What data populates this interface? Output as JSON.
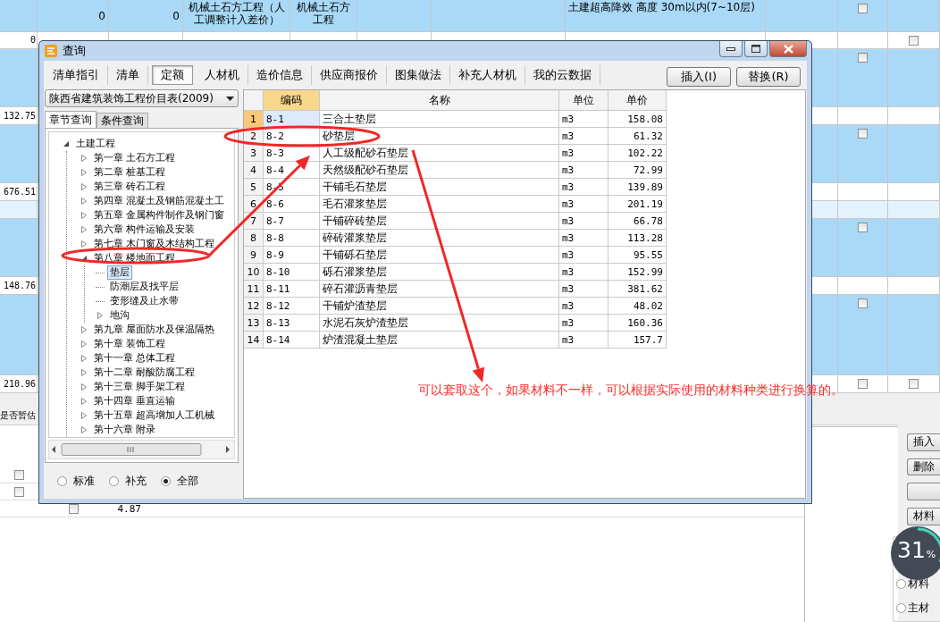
{
  "background": {
    "rows": [
      {
        "kind": "blue",
        "column_2": "0",
        "column_3": "0",
        "column_4": "机械土石方工程（人工调整计入差价）",
        "column_5": "机械土石方工程",
        "column_8": "土建超高降效 高度 30m以内(7~10层)",
        "column_10": {
          "checked": false
        }
      },
      {
        "kind": "white",
        "column_1": "0",
        "column_11": {
          "checked": false
        }
      },
      {
        "kind": "blue",
        "column_10": {
          "checked": false
        }
      },
      {
        "kind": "white",
        "column_1": "132.75"
      },
      {
        "kind": "blue",
        "column_10": {
          "checked": false
        }
      },
      {
        "kind": "white",
        "column_1": "676.51"
      },
      {
        "kind": "light"
      },
      {
        "kind": "blue",
        "column_10": {
          "checked": false
        }
      },
      {
        "kind": "white",
        "column_1": "148.76"
      },
      {
        "kind": "blue",
        "column_10": {
          "checked": false
        }
      },
      {
        "kind": "white",
        "column_1": "210.96",
        "column_10": {
          "checked": false
        },
        "column_11": {
          "checked": false
        }
      }
    ],
    "lower_table": {
      "header": "是否暂估",
      "rows": [
        {
          "checked": false
        },
        {
          "checked": false
        }
      ],
      "amount_row": {
        "checked": false,
        "value": "4.87"
      }
    },
    "side_buttons": [
      {
        "kind": "text",
        "label": "插入"
      },
      {
        "kind": "text",
        "label": "删除"
      },
      {
        "kind": "blank"
      },
      {
        "kind": "text",
        "label": "材料"
      }
    ],
    "side_radios": [
      {
        "label": "材料",
        "selected": false
      },
      {
        "label": "主材",
        "selected": false
      }
    ],
    "progress": {
      "value": "31",
      "unit": "%"
    }
  },
  "dialog": {
    "title": "查询",
    "tabs": [
      {
        "label": "清单指引",
        "selected": false
      },
      {
        "label": "清单",
        "selected": false
      },
      {
        "label": "定额",
        "selected": true
      },
      {
        "label": "人材机",
        "selected": false
      },
      {
        "label": "造价信息",
        "selected": false
      },
      {
        "label": "供应商报价",
        "selected": false
      },
      {
        "label": "图集做法",
        "selected": false
      },
      {
        "label": "补充人材机",
        "selected": false
      },
      {
        "label": "我的云数据",
        "selected": false
      }
    ],
    "buttons": [
      "插入(I)",
      "替换(R)"
    ],
    "catalog": "陕西省建筑装饰工程价目表(2009)",
    "subtabs": [
      {
        "label": "章节查询",
        "selected": true
      },
      {
        "label": "条件查询",
        "selected": false
      }
    ],
    "tree": [
      {
        "label": "土建工程",
        "kind": "branch",
        "expanded": true,
        "selected": false,
        "children": [
          {
            "label": "第一章 土石方工程",
            "kind": "branch",
            "expanded": false,
            "selected": false
          },
          {
            "label": "第二章 桩基工程",
            "kind": "branch",
            "expanded": false,
            "selected": false
          },
          {
            "label": "第三章 砖石工程",
            "kind": "branch",
            "expanded": false,
            "selected": false
          },
          {
            "label": "第四章 混凝土及钢筋混凝土工",
            "kind": "branch",
            "expanded": false,
            "selected": false
          },
          {
            "label": "第五章 金属构件制作及钢门窗",
            "kind": "branch",
            "expanded": false,
            "selected": false
          },
          {
            "label": "第六章 构件运输及安装",
            "kind": "branch",
            "expanded": false,
            "selected": false
          },
          {
            "label": "第七章 木门窗及木结构工程",
            "kind": "branch",
            "expanded": false,
            "selected": false
          },
          {
            "label": "第八章 楼地面工程",
            "kind": "branch",
            "expanded": true,
            "selected": false,
            "children": [
              {
                "label": "垫层",
                "kind": "leaf",
                "selected": true
              },
              {
                "label": "防潮层及找平层",
                "kind": "leaf",
                "selected": false
              },
              {
                "label": "变形缝及止水带",
                "kind": "leaf",
                "selected": false
              },
              {
                "label": "地沟",
                "kind": "branch",
                "expanded": false,
                "selected": false
              }
            ]
          },
          {
            "label": "第九章 屋面防水及保温隔热",
            "kind": "branch",
            "expanded": false,
            "selected": false
          },
          {
            "label": "第十章 装饰工程",
            "kind": "branch",
            "expanded": false,
            "selected": false
          },
          {
            "label": "第十一章 总体工程",
            "kind": "branch",
            "expanded": false,
            "selected": false
          },
          {
            "label": "第十二章 耐酸防腐工程",
            "kind": "branch",
            "expanded": false,
            "selected": false
          },
          {
            "label": "第十三章 脚手架工程",
            "kind": "branch",
            "expanded": false,
            "selected": false
          },
          {
            "label": "第十四章 垂直运输",
            "kind": "branch",
            "expanded": false,
            "selected": false
          },
          {
            "label": "第十五章 超高增加人工机械",
            "kind": "branch",
            "expanded": false,
            "selected": false
          },
          {
            "label": "第十六章 附录",
            "kind": "branch",
            "expanded": false,
            "selected": false
          }
        ]
      }
    ],
    "filters": [
      {
        "label": "标准",
        "selected": false
      },
      {
        "label": "补充",
        "selected": false
      },
      {
        "label": "全部",
        "selected": true
      }
    ],
    "table": {
      "columns": [
        "编码",
        "名称",
        "单位",
        "单价"
      ],
      "rows": [
        {
          "number": "1",
          "code": "8-1",
          "name": "三合土垫层",
          "unit": "m3",
          "price": "158.08",
          "selected": true
        },
        {
          "number": "2",
          "code": "8-2",
          "name": "砂垫层",
          "unit": "m3",
          "price": "61.32",
          "selected": false
        },
        {
          "number": "3",
          "code": "8-3",
          "name": "人工级配砂石垫层",
          "unit": "m3",
          "price": "102.22",
          "selected": false
        },
        {
          "number": "4",
          "code": "8-4",
          "name": "天然级配砂石垫层",
          "unit": "m3",
          "price": "72.99",
          "selected": false
        },
        {
          "number": "5",
          "code": "8-5",
          "name": "干铺毛石垫层",
          "unit": "m3",
          "price": "139.89",
          "selected": false
        },
        {
          "number": "6",
          "code": "8-6",
          "name": "毛石灌浆垫层",
          "unit": "m3",
          "price": "201.19",
          "selected": false
        },
        {
          "number": "7",
          "code": "8-7",
          "name": "干铺碎砖垫层",
          "unit": "m3",
          "price": "66.78",
          "selected": false
        },
        {
          "number": "8",
          "code": "8-8",
          "name": "碎砖灌浆垫层",
          "unit": "m3",
          "price": "113.28",
          "selected": false
        },
        {
          "number": "9",
          "code": "8-9",
          "name": "干铺砾石垫层",
          "unit": "m3",
          "price": "95.55",
          "selected": false
        },
        {
          "number": "10",
          "code": "8-10",
          "name": "砾石灌浆垫层",
          "unit": "m3",
          "price": "152.99",
          "selected": false
        },
        {
          "number": "11",
          "code": "8-11",
          "name": "碎石灌沥青垫层",
          "unit": "m3",
          "price": "381.62",
          "selected": false
        },
        {
          "number": "12",
          "code": "8-12",
          "name": "干铺炉渣垫层",
          "unit": "m3",
          "price": "48.02",
          "selected": false
        },
        {
          "number": "13",
          "code": "8-13",
          "name": "水泥石灰炉渣垫层",
          "unit": "m3",
          "price": "160.36",
          "selected": false
        },
        {
          "number": "14",
          "code": "8-14",
          "name": "炉渣混凝土垫层",
          "unit": "m3",
          "price": "157.7",
          "selected": false
        }
      ]
    }
  },
  "annotation": {
    "note": "可以套取这个，如果材料不一样，可以根据实际使用的材料种类进行换算的。"
  }
}
